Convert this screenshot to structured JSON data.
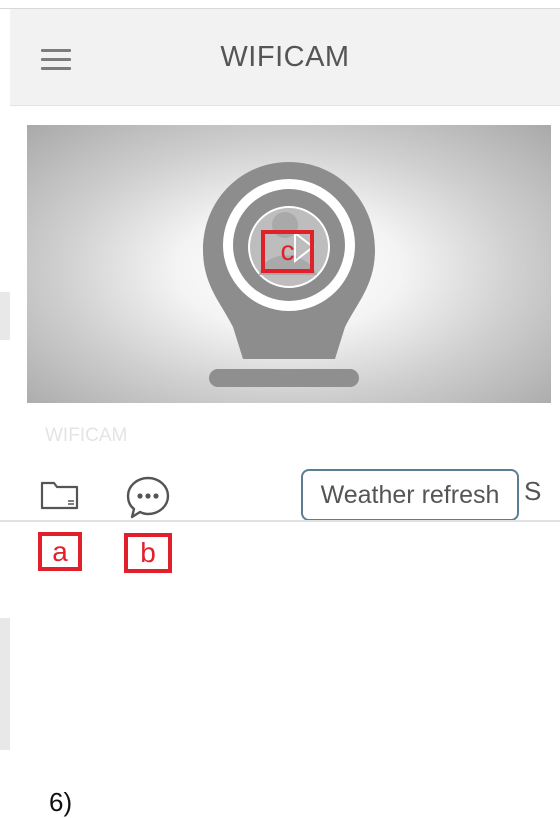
{
  "header": {
    "title": "WIFICAM"
  },
  "camera": {
    "name": "WIFICAM"
  },
  "toolbar": {
    "files_icon": "folder-icon",
    "messages_icon": "chat-bubble-icon",
    "weather_refresh_label": "Weather refresh",
    "clipped_char": "S"
  },
  "annotations": {
    "a": "a",
    "b": "b",
    "c": "c",
    "color": "#e0202a"
  },
  "footnote": "6)"
}
